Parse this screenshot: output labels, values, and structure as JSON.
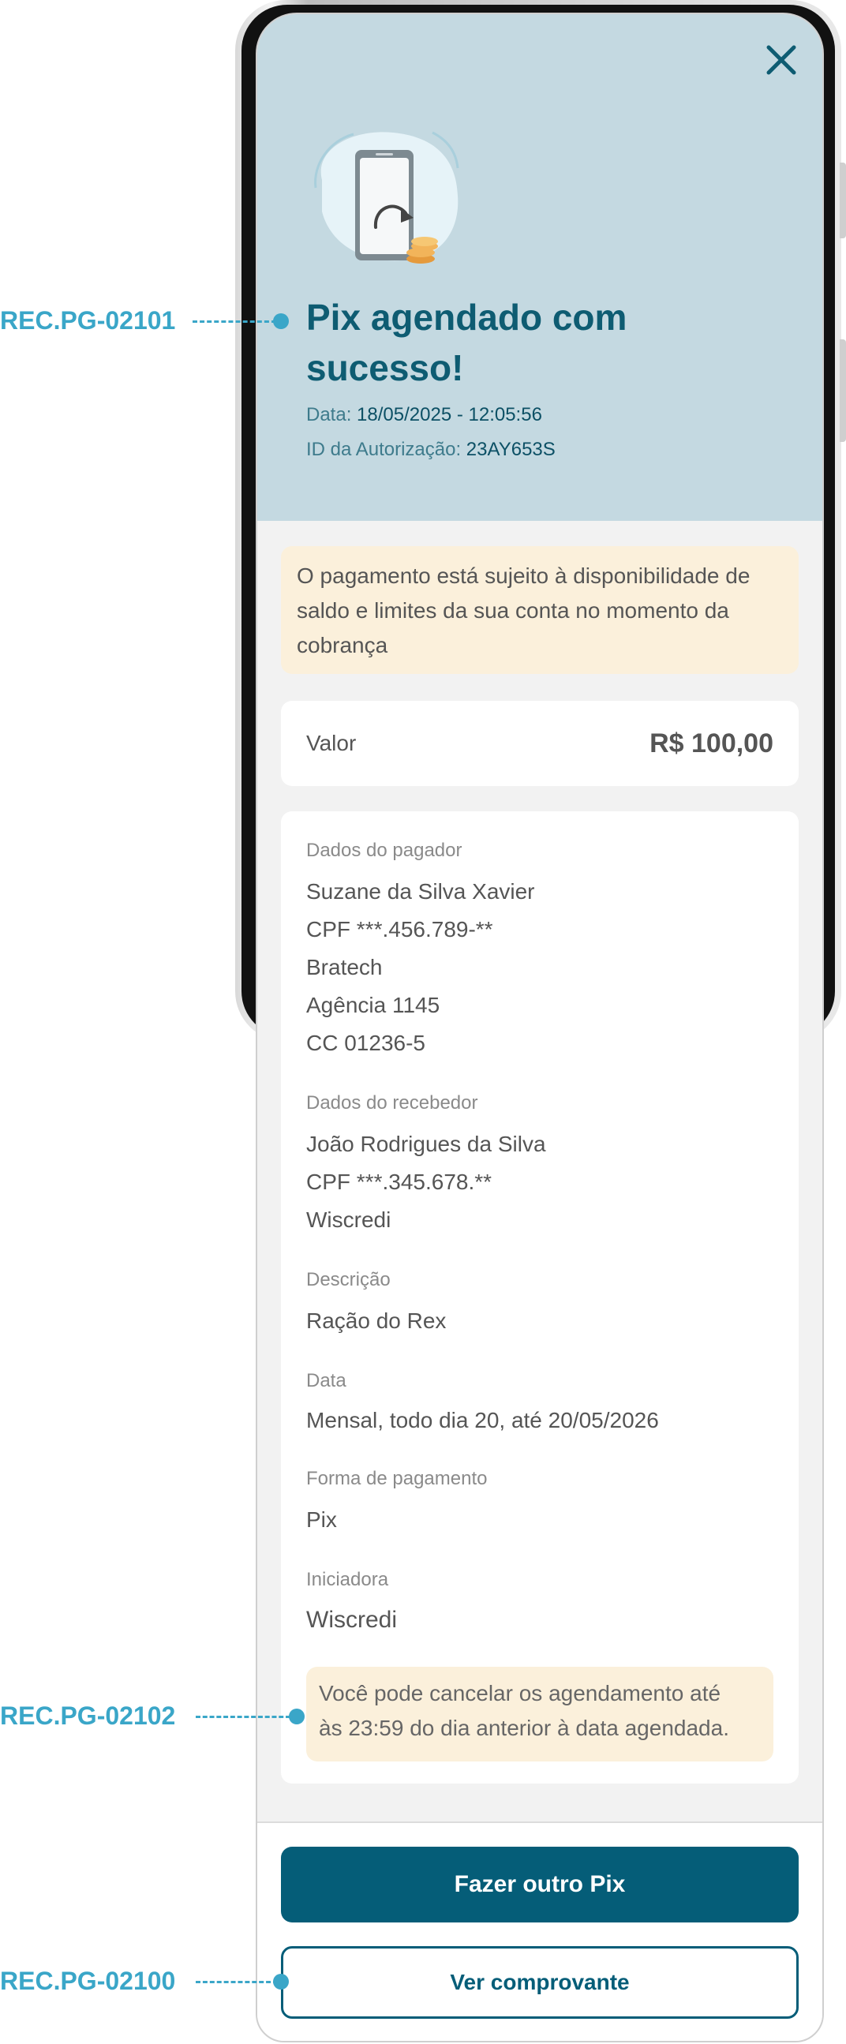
{
  "annotations": [
    "REC.PG-02101",
    "REC.PG-02102",
    "REC.PG-02100"
  ],
  "header": {
    "close_icon": "close-icon",
    "title_line1": "Pix agendado com",
    "title_line2": "sucesso!",
    "date_label": "Data:",
    "date_value": "18/05/2025 - 12:05:56",
    "auth_label": "ID da Autorização:",
    "auth_value": "23AY653S",
    "illustration_icon": "phone-transfer-coins-illustration"
  },
  "notice": {
    "line1": "O pagamento está sujeito à disponibilidade de",
    "line2": "saldo e limites da sua conta no momento da",
    "line3": "cobrança"
  },
  "value": {
    "label": "Valor",
    "amount": "R$ 100,00"
  },
  "payer": {
    "label": "Dados do pagador",
    "name": "Suzane da Silva Xavier",
    "cpf": "CPF ***.456.789-**",
    "bank": "Bratech",
    "agency": "Agência 1145",
    "account": "CC 01236-5"
  },
  "receiver": {
    "label": "Dados do recebedor",
    "name": "João Rodrigues da Silva",
    "cpf": "CPF ***.345.678.**",
    "bank": "Wiscredi"
  },
  "description": {
    "label": "Descrição",
    "value": "Ração do Rex"
  },
  "schedule": {
    "label": "Data",
    "value": "Mensal, todo dia 20, até 20/05/2026"
  },
  "payment_method": {
    "label": "Forma de pagamento",
    "value": "Pix"
  },
  "initiator": {
    "label": "Iniciadora",
    "value": "Wiscredi"
  },
  "warning": {
    "line1": "Você pode cancelar os agendamento até",
    "line2": "às 23:59 do dia anterior à data agendada."
  },
  "buttons": {
    "primary": "Fazer outro Pix",
    "secondary": "Ver comprovante"
  },
  "colors": {
    "header_bg": "#c4d9e1",
    "title": "#0e5c72",
    "primary_button": "#055d78",
    "notice_bg": "#fbf0db",
    "annotation": "#3aa6c8"
  }
}
